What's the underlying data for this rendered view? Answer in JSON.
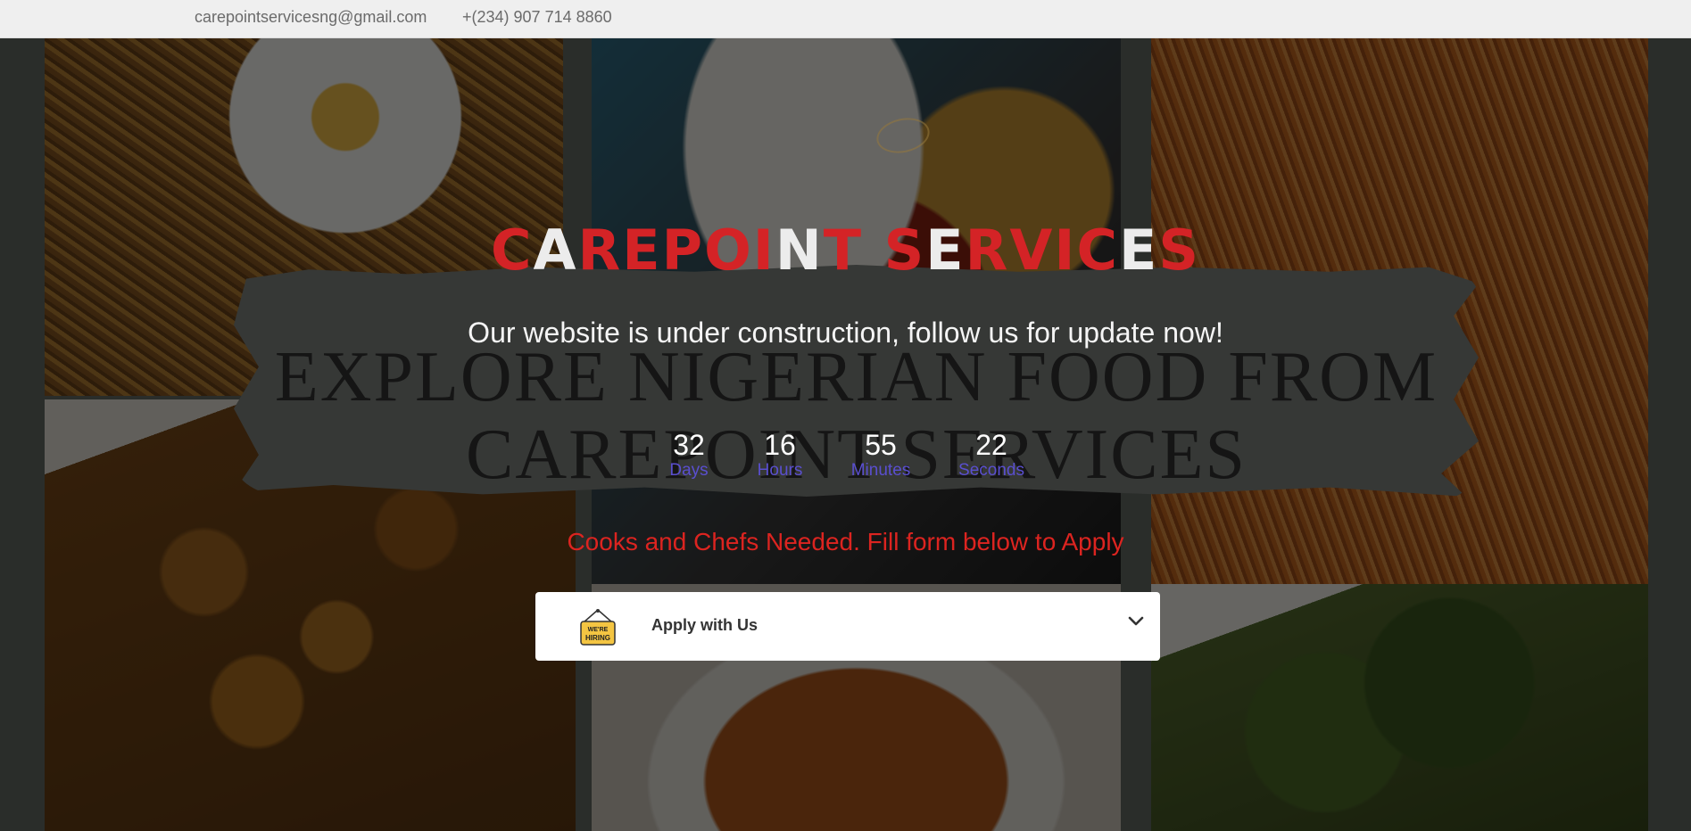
{
  "topbar": {
    "email": "carepointservicesng@gmail.com",
    "phone": "+(234) 907 714 8860"
  },
  "hero": {
    "title_letters": [
      {
        "ch": "C",
        "color": "red"
      },
      {
        "ch": "A",
        "color": "white"
      },
      {
        "ch": "R",
        "color": "red"
      },
      {
        "ch": "E",
        "color": "red"
      },
      {
        "ch": "P",
        "color": "red"
      },
      {
        "ch": "O",
        "color": "red"
      },
      {
        "ch": "I",
        "color": "red"
      },
      {
        "ch": "N",
        "color": "white"
      },
      {
        "ch": "T",
        "color": "red"
      },
      {
        "ch": " ",
        "color": "red"
      },
      {
        "ch": "S",
        "color": "red"
      },
      {
        "ch": "E",
        "color": "white"
      },
      {
        "ch": "R",
        "color": "red"
      },
      {
        "ch": "V",
        "color": "red"
      },
      {
        "ch": "I",
        "color": "red"
      },
      {
        "ch": "C",
        "color": "red"
      },
      {
        "ch": "E",
        "color": "white"
      },
      {
        "ch": "S",
        "color": "red"
      }
    ],
    "subtitle": "Our website is under construction, follow us for update now!",
    "background_heading_line1": "EXPLORE NIGERIAN FOOD FROM",
    "background_heading_line2": "CAREPOINT SERVICES",
    "colors": {
      "red": "#d42326",
      "white": "#ececec",
      "countdown_label": "#5a4fcf"
    }
  },
  "countdown": [
    {
      "value": "32",
      "label": "Days"
    },
    {
      "value": "16",
      "label": "Hours"
    },
    {
      "value": "55",
      "label": "Minutes"
    },
    {
      "value": "22",
      "label": "Seconds"
    }
  ],
  "notice": "Cooks and Chefs Needed. Fill form below to Apply",
  "accordion": {
    "label": "Apply with Us",
    "icon_text": "WE'RE HIRING",
    "icon": "hiring-sign-icon",
    "toggle_icon": "chevron-down-icon"
  }
}
